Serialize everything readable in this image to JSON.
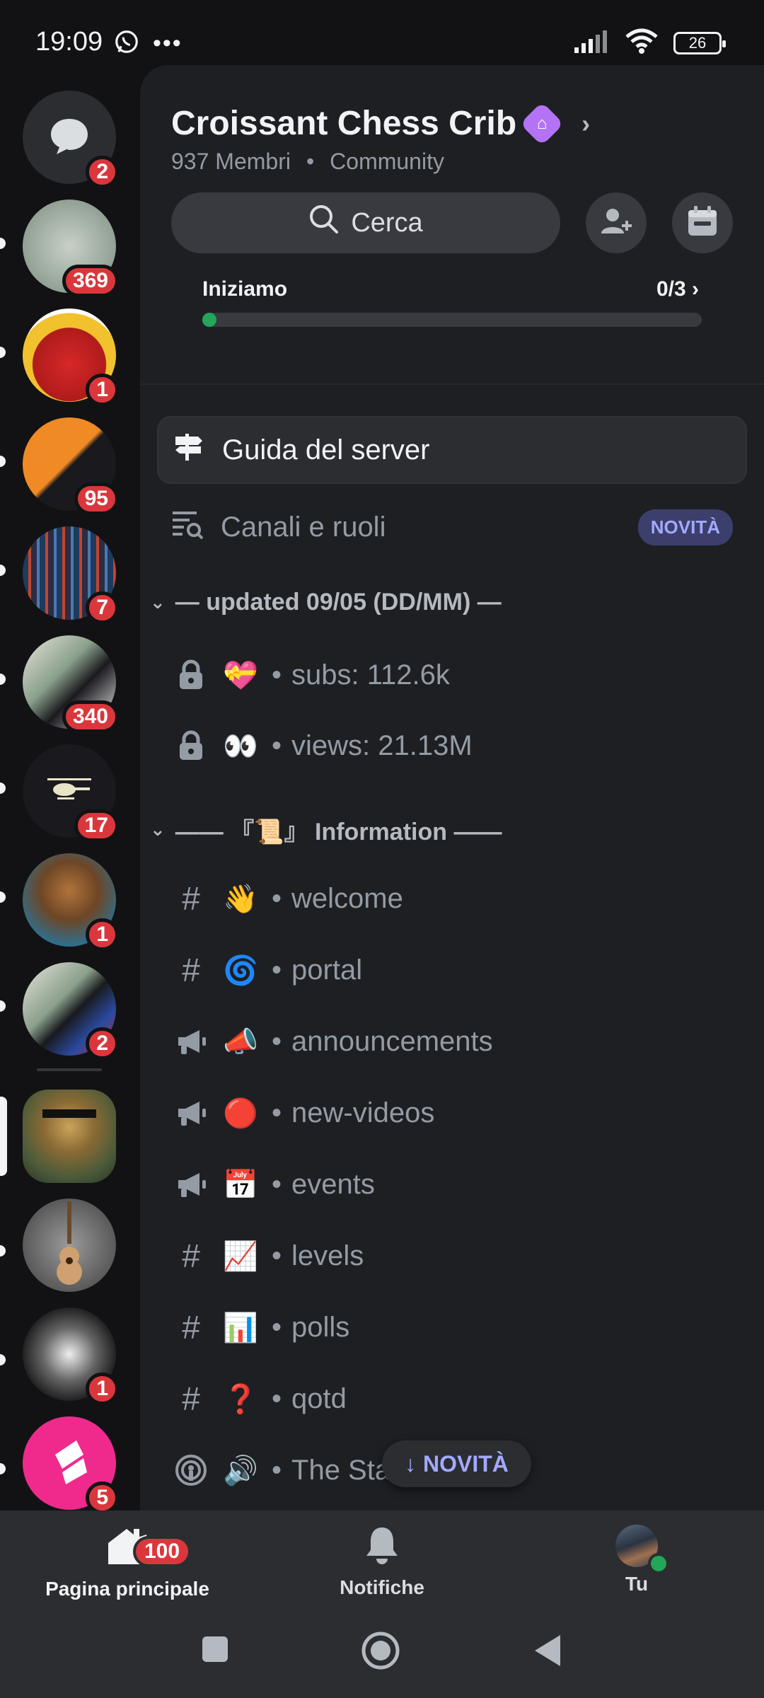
{
  "status_bar": {
    "time": "19:09",
    "battery": "26"
  },
  "rail": {
    "dm_badge": "2",
    "servers": [
      {
        "name": "server-1",
        "badge": "369"
      },
      {
        "name": "server-2",
        "badge": "1"
      },
      {
        "name": "server-3",
        "badge": "95"
      },
      {
        "name": "server-4",
        "badge": "7"
      },
      {
        "name": "server-5",
        "badge": "340"
      },
      {
        "name": "server-6",
        "badge": "17"
      },
      {
        "name": "server-7",
        "badge": "1"
      },
      {
        "name": "server-8",
        "badge": "2"
      },
      {
        "name": "server-active",
        "badge": ""
      },
      {
        "name": "server-10",
        "badge": ""
      },
      {
        "name": "server-11",
        "badge": "1"
      },
      {
        "name": "server-12",
        "badge": "5"
      }
    ]
  },
  "header": {
    "server_name": "Croissant Chess Crib",
    "members": "937 Membri",
    "type": "Community",
    "search_label": "Cerca"
  },
  "onboarding": {
    "label": "Iniziamo",
    "count": "0/3",
    "progress": 0.02
  },
  "guide": {
    "label": "Guida del server"
  },
  "roles": {
    "label": "Canali e ruoli",
    "badge": "NOVITÀ"
  },
  "categories": [
    {
      "title": "— updated 09/05 (DD/MM) —",
      "channels": [
        {
          "icon": "lock-icon",
          "emoji": "💝",
          "name": "subs: 112.6k"
        },
        {
          "icon": "lock-icon",
          "emoji": "👀",
          "name": "views: 21.13M"
        }
      ]
    },
    {
      "title": "—— 『📜』 Information ——",
      "channels": [
        {
          "icon": "hash-icon",
          "emoji": "👋",
          "name": "welcome"
        },
        {
          "icon": "hash-icon",
          "emoji": "🌀",
          "name": "portal"
        },
        {
          "icon": "megaphone-icon",
          "emoji": "📣",
          "name": "announcements"
        },
        {
          "icon": "megaphone-icon",
          "emoji": "🔴",
          "name": "new-videos"
        },
        {
          "icon": "megaphone-icon",
          "emoji": "📅",
          "name": "events"
        },
        {
          "icon": "hash-icon",
          "emoji": "📈",
          "name": "levels"
        },
        {
          "icon": "hash-icon",
          "emoji": "📊",
          "name": "polls"
        },
        {
          "icon": "hash-icon",
          "emoji": "❓",
          "name": "qotd"
        },
        {
          "icon": "stage-icon",
          "emoji": "🔊",
          "name": "The Sta"
        }
      ]
    }
  ],
  "new_float": {
    "label": "NOVITÀ"
  },
  "bottom_nav": {
    "home_label": "Pagina principale",
    "home_badge": "100",
    "notifications_label": "Notifiche",
    "you_label": "Tu"
  },
  "colors": {
    "accent": "#5865f2",
    "danger": "#da373c",
    "online": "#23a55a",
    "boost": "#b473f5"
  }
}
